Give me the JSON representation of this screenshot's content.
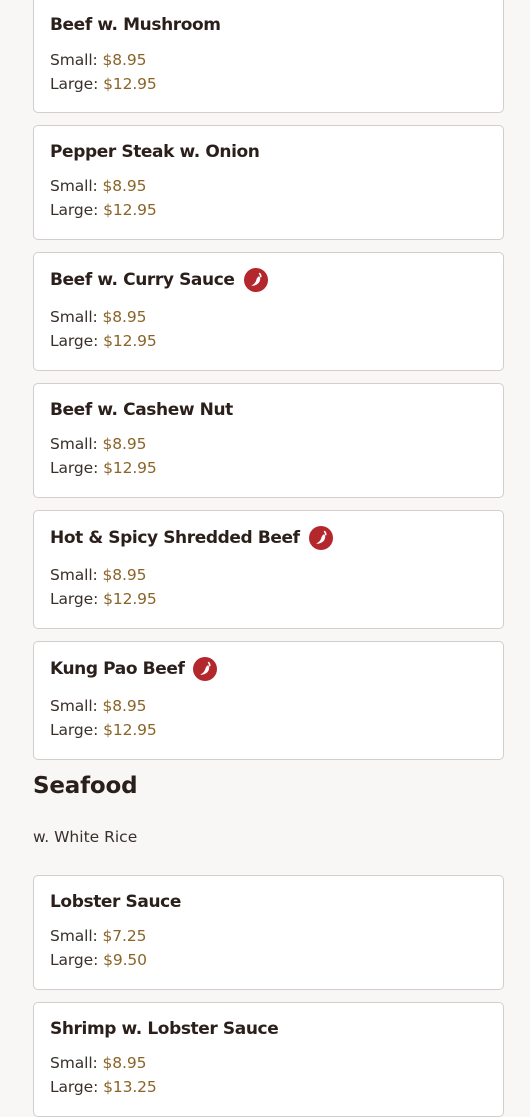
{
  "colors": {
    "background": "#f8f7f5",
    "card_border": "#d3cecb",
    "price_value": "#8a6428",
    "spicy_icon": "#b3282c"
  },
  "menu": {
    "items": [
      {
        "name": "Beef w. Mushroom",
        "spicy": false,
        "small_label": "Small:",
        "small_price": "$8.95",
        "large_label": "Large:",
        "large_price": "$12.95"
      },
      {
        "name": "Pepper Steak w. Onion",
        "spicy": false,
        "small_label": "Small:",
        "small_price": "$8.95",
        "large_label": "Large:",
        "large_price": "$12.95"
      },
      {
        "name": "Beef w. Curry Sauce",
        "spicy": true,
        "small_label": "Small:",
        "small_price": "$8.95",
        "large_label": "Large:",
        "large_price": "$12.95"
      },
      {
        "name": "Beef w. Cashew Nut",
        "spicy": false,
        "small_label": "Small:",
        "small_price": "$8.95",
        "large_label": "Large:",
        "large_price": "$12.95"
      },
      {
        "name": "Hot & Spicy Shredded Beef",
        "spicy": true,
        "small_label": "Small:",
        "small_price": "$8.95",
        "large_label": "Large:",
        "large_price": "$12.95"
      },
      {
        "name": "Kung Pao Beef",
        "spicy": true,
        "small_label": "Small:",
        "small_price": "$8.95",
        "large_label": "Large:",
        "large_price": "$12.95"
      }
    ],
    "seafood": {
      "title": "Seafood",
      "subtitle": "w. White Rice",
      "items": [
        {
          "name": "Lobster Sauce",
          "spicy": false,
          "small_label": "Small:",
          "small_price": "$7.25",
          "large_label": "Large:",
          "large_price": "$9.50"
        },
        {
          "name": "Shrimp w. Lobster Sauce",
          "spicy": false,
          "small_label": "Small:",
          "small_price": "$8.95",
          "large_label": "Large:",
          "large_price": "$13.25"
        }
      ]
    }
  }
}
